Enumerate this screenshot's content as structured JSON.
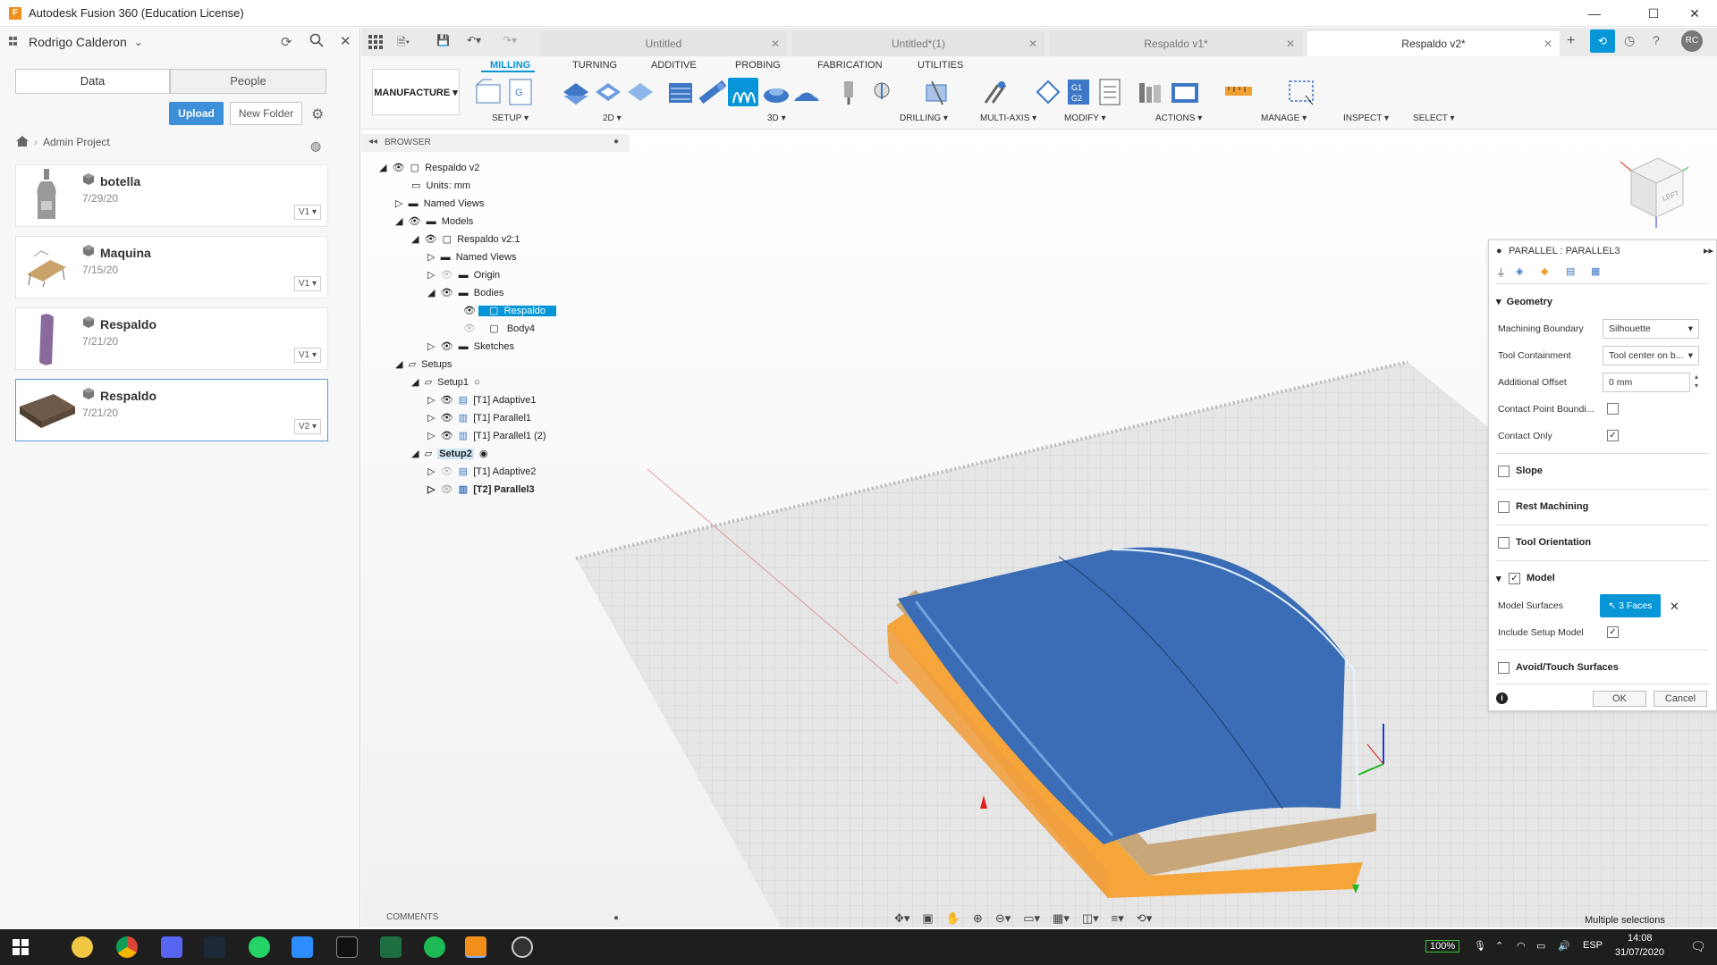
{
  "app": {
    "title": "Autodesk Fusion 360 (Education License)",
    "icon_letter": "F"
  },
  "user": {
    "name": "Rodrigo Calderon"
  },
  "data_panel": {
    "tabs": [
      "Data",
      "People"
    ],
    "upload_label": "Upload",
    "new_folder_label": "New Folder",
    "project": "Admin Project",
    "files": [
      {
        "name": "botella",
        "date": "7/29/20",
        "version": "V1"
      },
      {
        "name": "Maquina",
        "date": "7/15/20",
        "version": "V1"
      },
      {
        "name": "Respaldo",
        "date": "7/21/20",
        "version": "V1"
      },
      {
        "name": "Respaldo",
        "date": "7/21/20",
        "version": "V2"
      }
    ]
  },
  "doc_tabs": [
    {
      "label": "Untitled"
    },
    {
      "label": "Untitled*(1)"
    },
    {
      "label": "Respaldo v1*"
    },
    {
      "label": "Respaldo v2*"
    }
  ],
  "user_initials": "RC",
  "ribbon": {
    "workspace": "MANUFACTURE",
    "tabs": [
      "MILLING",
      "TURNING",
      "ADDITIVE",
      "PROBING",
      "FABRICATION",
      "UTILITIES"
    ],
    "groups": [
      "SETUP",
      "2D",
      "3D",
      "DRILLING",
      "MULTI-AXIS",
      "MODIFY",
      "ACTIONS",
      "MANAGE",
      "INSPECT",
      "SELECT"
    ]
  },
  "browser": {
    "title": "BROWSER",
    "items": [
      {
        "label": "Respaldo v2"
      },
      {
        "label": "Units: mm"
      },
      {
        "label": "Named Views"
      },
      {
        "label": "Models"
      },
      {
        "label": "Respaldo v2:1"
      },
      {
        "label": "Named Views"
      },
      {
        "label": "Origin"
      },
      {
        "label": "Bodies"
      },
      {
        "label": "Respaldo"
      },
      {
        "label": "Body4"
      },
      {
        "label": "Sketches"
      },
      {
        "label": "Setups"
      },
      {
        "label": "Setup1"
      },
      {
        "label": "[T1] Adaptive1"
      },
      {
        "label": "[T1] Parallel1"
      },
      {
        "label": "[T1] Parallel1 (2)"
      },
      {
        "label": "Setup2"
      },
      {
        "label": "[T1] Adaptive2"
      },
      {
        "label": "[T2] Parallel3"
      }
    ]
  },
  "view_cube": {
    "label": "LEFT"
  },
  "props": {
    "title": "PARALLEL : PARALLEL3",
    "geometry": "Geometry",
    "machining_boundary_label": "Machining Boundary",
    "machining_boundary_value": "Silhouette",
    "tool_containment_label": "Tool Containment",
    "tool_containment_value": "Tool center on b...",
    "additional_offset_label": "Additional Offset",
    "additional_offset_value": "0 mm",
    "contact_point_label": "Contact Point Boundi...",
    "contact_only_label": "Contact Only",
    "slope": "Slope",
    "rest_machining": "Rest Machining",
    "tool_orientation": "Tool Orientation",
    "model": "Model",
    "model_surfaces_label": "Model Surfaces",
    "model_surfaces_value": "3 Faces",
    "include_setup_model_label": "Include Setup Model",
    "avoid_touch": "Avoid/Touch Surfaces",
    "ok": "OK",
    "cancel": "Cancel"
  },
  "comments": "COMMENTS",
  "status": "Multiple selections",
  "taskbar": {
    "battery": "100%",
    "lang": "ESP",
    "time": "14:08",
    "date": "31/07/2020"
  },
  "colors": {
    "accent": "#0696d7",
    "toolpath_orange": "#f5a53a",
    "surface_blue": "#3a6db5",
    "taskbar": "#1e1e1e"
  }
}
